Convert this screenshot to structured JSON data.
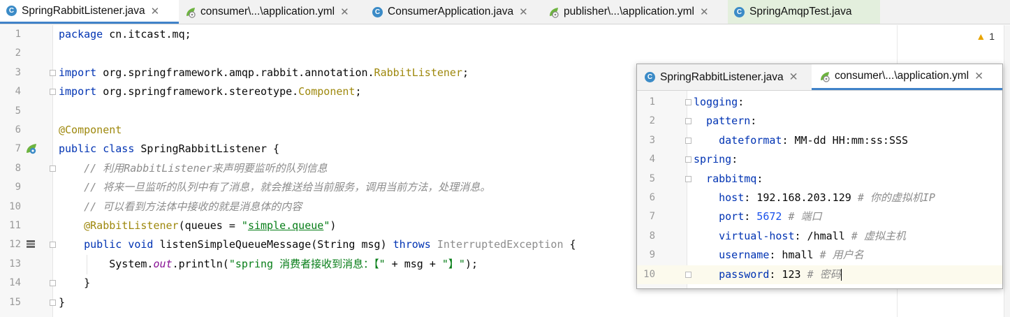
{
  "tabs": [
    {
      "label": "SpringRabbitListener.java",
      "icon": "java-class-icon",
      "active": true
    },
    {
      "label": "consumer\\...\\application.yml",
      "icon": "spring-yml-icon"
    },
    {
      "label": "ConsumerApplication.java",
      "icon": "java-class-icon"
    },
    {
      "label": "publisher\\...\\application.yml",
      "icon": "spring-yml-icon"
    },
    {
      "label": "SpringAmqpTest.java",
      "icon": "java-test-icon"
    }
  ],
  "close_glyph": "✕",
  "inspections": {
    "icon": "warning-icon",
    "count": "1"
  },
  "java_lines": [
    "1",
    "2",
    "3",
    "4",
    "5",
    "6",
    "7",
    "8",
    "9",
    "10",
    "11",
    "12",
    "13",
    "14",
    "15"
  ],
  "code": {
    "l1_kw": "package",
    "l1_rest": " cn.itcast.mq;",
    "l3_kw": "import",
    "l3_pkg": " org.springframework.amqp.rabbit.annotation.",
    "l3_cls": "RabbitListener",
    "l3_end": ";",
    "l4_kw": "import",
    "l4_pkg": " org.springframework.stereotype.",
    "l4_cls": "Component",
    "l4_end": ";",
    "l6": "@Component",
    "l7_kw": "public class",
    "l7_rest": " SpringRabbitListener {",
    "l8": "    // 利用RabbitListener来声明要监听的队列信息",
    "l9": "    // 将来一旦监听的队列中有了消息，就会推送给当前服务，调用当前方法，处理消息。",
    "l10": "    // 可以看到方法体中接收的就是消息体的内容",
    "l11_ann": "    @RabbitListener",
    "l11_a": "(queues = ",
    "l11_q1": "\"",
    "l11_str": "simple.queue",
    "l11_q2": "\"",
    "l11_end": ")",
    "l12_kw": "    public void",
    "l12_name": " listenSimpleQueueMessage(String msg) ",
    "l12_throws": "throws",
    "l12_ex": " InterruptedException",
    "l12_end": " {",
    "l13_a": "        System.",
    "l13_out": "out",
    "l13_b": ".println(",
    "l13_s1": "\"spring 消费者接收到消息：【\"",
    "l13_c": " + msg + ",
    "l13_s2": "\"】\"",
    "l13_d": ");",
    "l14": "    }",
    "l15": "}"
  },
  "popup": {
    "tabs": [
      {
        "label": "SpringRabbitListener.java",
        "icon": "java-class-icon"
      },
      {
        "label": "consumer\\...\\application.yml",
        "icon": "spring-yml-icon",
        "active": true
      }
    ],
    "lines": [
      "1",
      "2",
      "3",
      "4",
      "5",
      "6",
      "7",
      "8",
      "9",
      "10"
    ],
    "yml": {
      "l1k": "logging",
      "colon": ":",
      "l2k": "  pattern",
      "l3k": "    dateformat",
      "l3v": " MM-dd HH:mm:ss:SSS",
      "l4k": "spring",
      "l5k": "  rabbitmq",
      "l6k": "    host",
      "l6v": " 192.168.203.129 ",
      "l6c": "# 你的虚拟机IP",
      "l7k": "    port",
      "l7v": " 5672 ",
      "l7c": "# 端口",
      "l8k": "    virtual-host",
      "l8v": " /hmall ",
      "l8c": "# 虚拟主机",
      "l9k": "    username",
      "l9v": " hmall ",
      "l9c": "# 用户名",
      "l10k": "    password",
      "l10v": " 123 ",
      "l10c": "# 密码"
    }
  }
}
